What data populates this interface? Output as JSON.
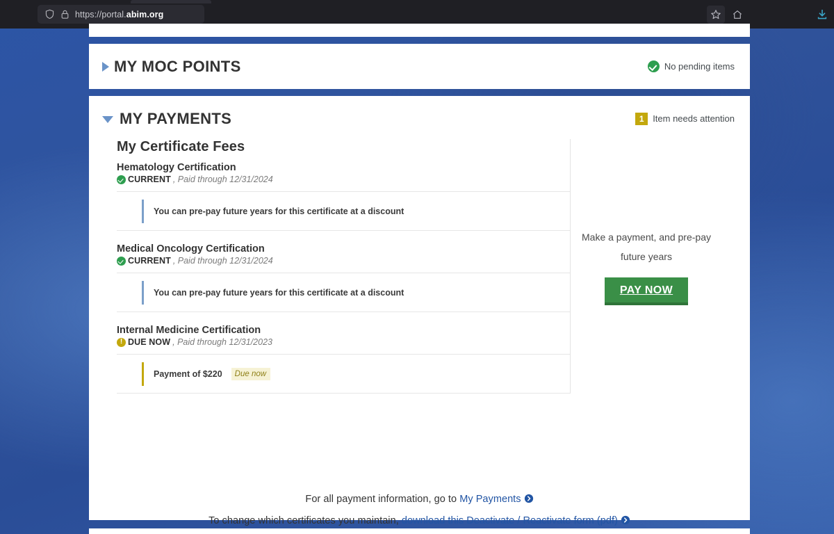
{
  "browser": {
    "url_prefix": "https://portal.",
    "url_domain": "abim.org",
    "shield_icon": "shield-icon",
    "lock_icon": "lock-icon",
    "star_icon": "bookmark-star-icon",
    "home_icon": "home-icon",
    "download_icon": "download-icon",
    "download_color": "#3aa6c8"
  },
  "sections": {
    "moc": {
      "title": "MY MOC POINTS",
      "collapsed": true,
      "status_text": "No pending items",
      "status_icon": "check-circle-icon",
      "status_color": "#2e9e4f"
    },
    "payments": {
      "title": "MY PAYMENTS",
      "collapsed": false,
      "status_count": "1",
      "status_text": "Item needs attention",
      "status_color": "#c3a80d"
    }
  },
  "fees": {
    "title": "My Certificate Fees",
    "certificates": [
      {
        "name": "Hematology Certification",
        "status_label": "CURRENT",
        "status_icon": "check-circle-icon",
        "status_kind": "ok",
        "paid_through": ", Paid through 12/31/2024",
        "note": "You can pre-pay future years for this certificate at a discount",
        "note_kind": "blue",
        "badge": null
      },
      {
        "name": "Medical Oncology Certification",
        "status_label": "CURRENT",
        "status_icon": "check-circle-icon",
        "status_kind": "ok",
        "paid_through": ", Paid through 12/31/2024",
        "note": "You can pre-pay future years for this certificate at a discount",
        "note_kind": "blue",
        "badge": null
      },
      {
        "name": "Internal Medicine Certification",
        "status_label": "DUE NOW",
        "status_icon": "warning-circle-icon",
        "status_kind": "warn",
        "paid_through": ", Paid through 12/31/2023",
        "note": "Payment of $220",
        "note_kind": "gold",
        "badge": "Due now"
      }
    ]
  },
  "paynow": {
    "caption_line1": "Make a payment, and pre-pay",
    "caption_line2": "future years",
    "button_label": "PAY NOW",
    "button_color": "#3a8f47"
  },
  "footer": {
    "line1_prefix": "For all payment information, go to ",
    "line1_link": "My Payments",
    "line2_prefix": "To change which certificates you maintain, ",
    "line2_link": "download this Deactivate / Reactivate form (pdf)",
    "link_color": "#2255a4",
    "arrow_icon": "chevron-right-circle-icon"
  }
}
